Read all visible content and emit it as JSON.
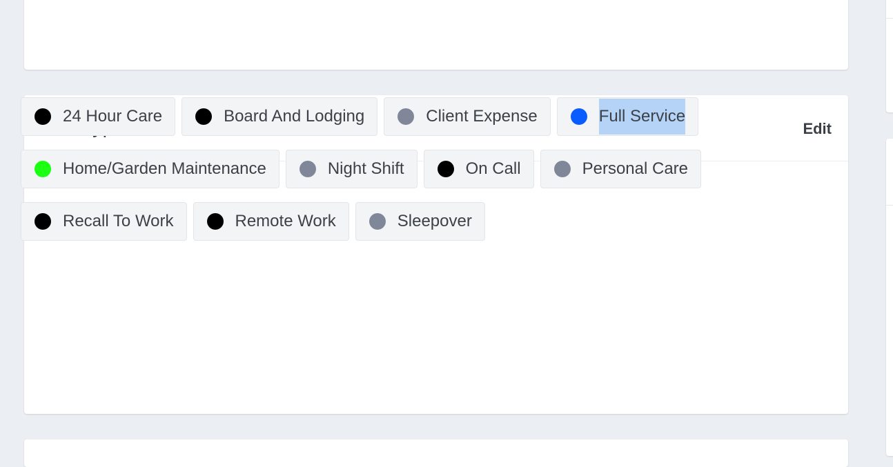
{
  "section": {
    "title": "Shift types",
    "edit_label": "Edit"
  },
  "shift_types": [
    {
      "label": "24 Hour Care",
      "color": "#000000"
    },
    {
      "label": "Board And Lodging",
      "color": "#000000"
    },
    {
      "label": "Client Expense",
      "color": "#7f8798"
    },
    {
      "label": "Full Service",
      "color": "#0a5cff",
      "text_selected": true
    },
    {
      "label": "Home/Garden Maintenance",
      "color": "#1bff12"
    },
    {
      "label": "Night Shift",
      "color": "#7f8798"
    },
    {
      "label": "On Call",
      "color": "#000000"
    },
    {
      "label": "Personal Care",
      "color": "#7f8798"
    },
    {
      "label": "Recall To Work",
      "color": "#000000"
    },
    {
      "label": "Remote Work",
      "color": "#000000"
    },
    {
      "label": "Sleepover",
      "color": "#7f8798"
    }
  ]
}
